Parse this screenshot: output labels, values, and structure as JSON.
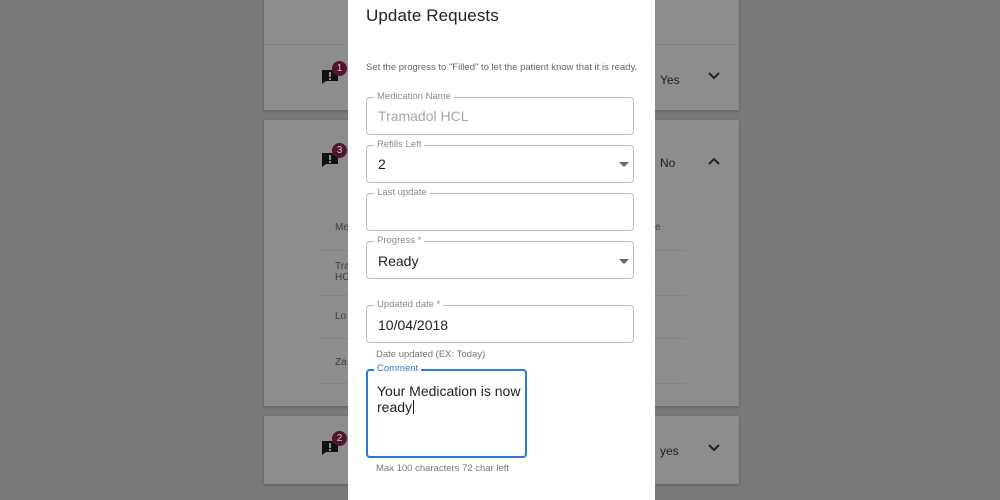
{
  "background": {
    "rows": [
      {
        "badge": "1",
        "status": "Yes"
      },
      {
        "badge": "3",
        "status": "No",
        "table": {
          "header": "Me",
          "header_right": "e",
          "rows": [
            "Tra\nHC",
            "Lo",
            "Za"
          ]
        }
      },
      {
        "badge": "2",
        "status": "yes"
      }
    ]
  },
  "dialog": {
    "title": "Update Requests",
    "description": "Set the progress to \"Filled\" to let the patient know that it is ready.",
    "fields": {
      "medication_name": {
        "label": "Medication Name",
        "value": "Tramadol HCL"
      },
      "refills_left": {
        "label": "Refills Left",
        "value": "2"
      },
      "last_update": {
        "label": "Last update",
        "value": ""
      },
      "progress": {
        "label": "Progress *",
        "value": "Ready"
      },
      "updated_date": {
        "label": "Updated date *",
        "value": "10/04/2018",
        "helper": "Date updated (EX: Today)"
      },
      "comment": {
        "label": "Comment",
        "value": "Your Medication is now ready",
        "helper": "Max 100 characters 72 char left"
      }
    }
  },
  "colors": {
    "overlay": "#7a7a7a",
    "accent": "#2c7ad6",
    "badge": "#54122f"
  }
}
